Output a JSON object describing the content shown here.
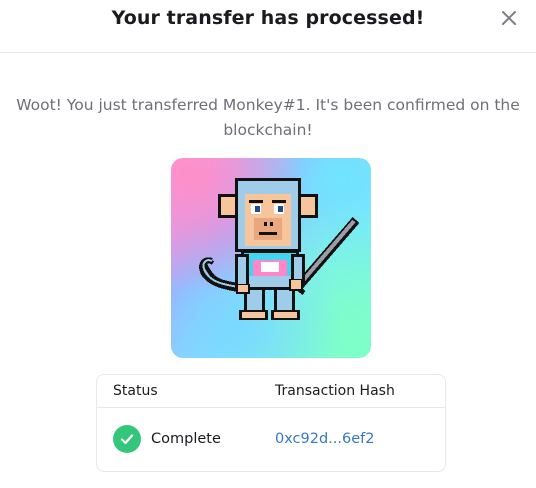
{
  "modal": {
    "title": "Your transfer has processed!",
    "message": "Woot! You just transferred Monkey#1. It's been confirmed on the blockchain!"
  },
  "nft": {
    "alt": "Monkey#1"
  },
  "table": {
    "headers": {
      "status": "Status",
      "hash": "Transaction Hash"
    },
    "row": {
      "status": "Complete",
      "hash": "0xc92d...6ef2"
    }
  },
  "icons": {
    "close": "close-icon",
    "check": "check-circle-icon"
  },
  "colors": {
    "status_complete": "#34c77b",
    "link": "#3578c4"
  }
}
